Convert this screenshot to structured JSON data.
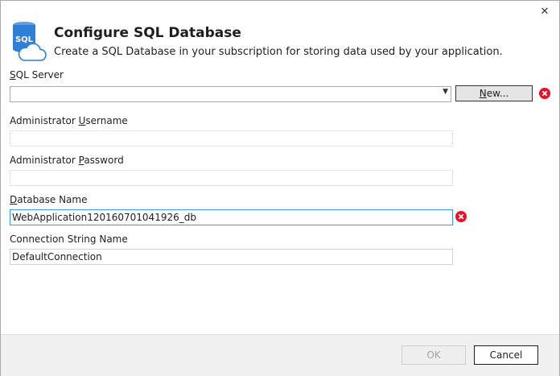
{
  "header": {
    "title": "Configure SQL Database",
    "subtitle": "Create a SQL Database in your subscription for storing data used by your application.",
    "icon": "sql-cloud-icon",
    "icon_text": "SQL"
  },
  "window": {
    "close_glyph": "✕"
  },
  "sql_server": {
    "label_pre": "",
    "label_accel": "S",
    "label_post": "QL Server",
    "value": "",
    "new_button_accel": "N",
    "new_button_rest": "ew..."
  },
  "admin_username": {
    "label_pre": "Administrator ",
    "label_accel": "U",
    "label_post": "sername",
    "value": ""
  },
  "admin_password": {
    "label_pre": "Administrator ",
    "label_accel": "P",
    "label_post": "assword",
    "value": ""
  },
  "database_name": {
    "label_pre": "",
    "label_accel": "D",
    "label_post": "atabase Name",
    "value": "WebApplication120160701041926_db"
  },
  "connection_string": {
    "label_pre": "Connection String Name",
    "value": "DefaultConnection"
  },
  "footer": {
    "ok_label": "OK",
    "cancel_label": "Cancel"
  },
  "colors": {
    "accent": "#3399ff",
    "error": "#e81123",
    "icon_blue": "#2f7fd6"
  }
}
